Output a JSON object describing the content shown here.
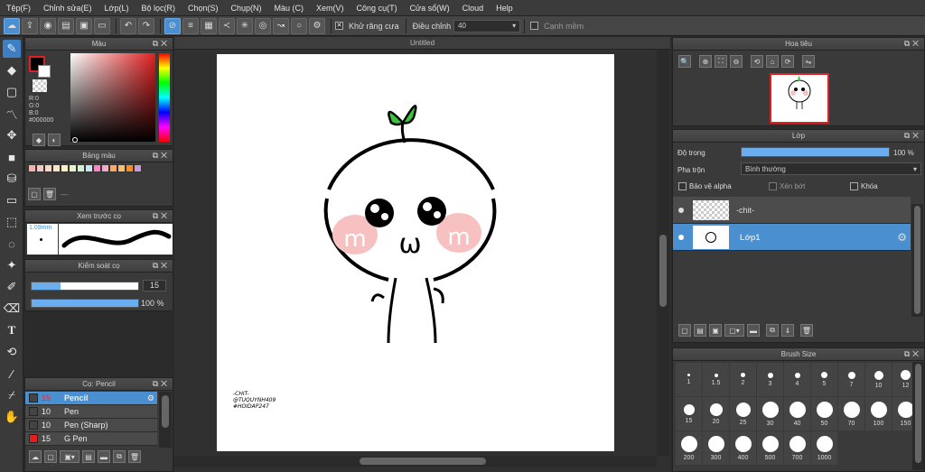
{
  "menu": [
    "Tệp(F)",
    "Chỉnh sửa(E)",
    "Lớp(L)",
    "Bộ lọc(R)",
    "Chọn(S)",
    "Chụp(N)",
    "Màu (C)",
    "Xem(V)",
    "Công cụ(T)",
    "Cửa sổ(W)",
    "Cloud",
    "Help"
  ],
  "toolbar": {
    "antialias_label": "Khử răng cưa",
    "adjust_label": "Điều chỉnh",
    "adjust_value": "40",
    "smooth_label": "Cạnh mềm"
  },
  "color_panel": {
    "title": "Màu",
    "r": "R:0",
    "g": "G:0",
    "b": "B:0",
    "hex": "#000000"
  },
  "palette_panel": {
    "title": "Bảng màu",
    "name": "---",
    "colors": [
      "#f2b3b3",
      "#f5c6c6",
      "#f9d7c4",
      "#fbe3c7",
      "#fff2c6",
      "#e6f5c8",
      "#d0efd6",
      "#c6e6f1",
      "#f28ac0",
      "#f4a9c9",
      "#f6a96a",
      "#f7c06c",
      "#f58c2a",
      "#c89bd6"
    ]
  },
  "brush_preview": {
    "title": "Xem trước cọ",
    "size": "1.09mm"
  },
  "brush_control": {
    "title": "Kiểm soát cọ",
    "size_value": "15",
    "opacity_value": "100 %",
    "size_fraction": 0.27,
    "opacity_fraction": 1.0
  },
  "brush_list": {
    "title": "Cọ: Pencil",
    "items": [
      {
        "size": "15",
        "name": "Pencil",
        "color": "#444444"
      },
      {
        "size": "10",
        "name": "Pen",
        "color": "#444444"
      },
      {
        "size": "10",
        "name": "Pen (Sharp)",
        "color": "#444444"
      },
      {
        "size": "15",
        "name": "G Pen",
        "color": "#e02020"
      }
    ]
  },
  "canvas": {
    "tab_title": "Untitled",
    "watermark": [
      "-CHIT-",
      "@TUQUYNH409",
      "#HOIDAP247"
    ],
    "mouth_text": "ω",
    "blush_text": "m"
  },
  "navigator": {
    "title": "Hoa tiêu"
  },
  "layer_panel": {
    "title": "Lớp",
    "opacity_label": "Độ trong",
    "opacity_value": "100 %",
    "opacity_fraction": 1.0,
    "blend_label": "Pha trộn",
    "blend_value": "Bình thường",
    "protect_alpha": "Bảo vệ alpha",
    "clipping": "Xén bớt",
    "lock": "Khóa",
    "layers": [
      {
        "name": "-chit-"
      },
      {
        "name": "Lớp1"
      }
    ]
  },
  "brush_size": {
    "title": "Brush Size",
    "sizes": [
      "1",
      "1.5",
      "2",
      "3",
      "4",
      "5",
      "7",
      "10",
      "12",
      "15",
      "20",
      "25",
      "30",
      "40",
      "50",
      "70",
      "100",
      "150",
      "200",
      "300",
      "400",
      "500",
      "700",
      "1000"
    ]
  }
}
